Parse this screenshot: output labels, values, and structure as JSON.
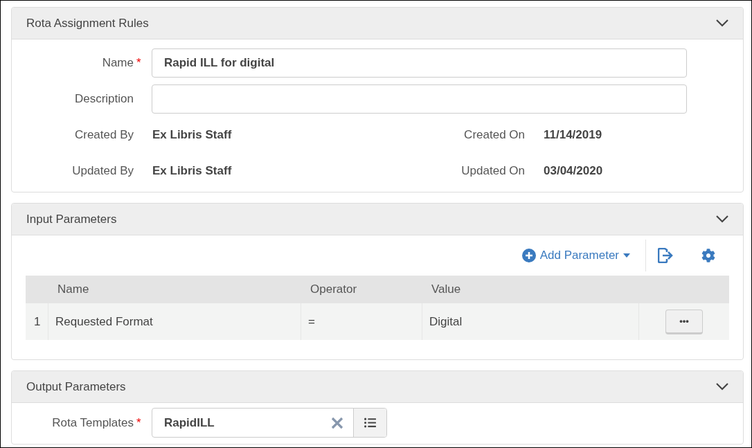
{
  "general": {
    "title": "Rota Assignment Rules",
    "expanded": true,
    "fields": [
      {
        "label": "Name",
        "required_mark": "*",
        "value": "Rapid ILL for digital"
      },
      {
        "label": "Description"
      }
    ],
    "info": [
      {
        "label": "Created By",
        "value": "Ex Libris Staff",
        "label_2": "Created On",
        "value_2": "11/14/2019"
      },
      {
        "label": "Updated By",
        "value": "Ex Libris Staff",
        "label_2": "Updated On",
        "value_2": "03/04/2020"
      }
    ]
  },
  "input_parameters": {
    "title": "Input Parameters",
    "expanded": true,
    "add_button": "Add Parameter",
    "columns": [
      "Name",
      "Operator",
      "Value"
    ],
    "rows": [
      {
        "index": "1",
        "name": "Requested Format",
        "operator": "=",
        "value": "Digital",
        "action": "•••"
      }
    ]
  },
  "output_parameters": {
    "title": "Output Parameters",
    "expanded": true,
    "field": {
      "label": "Rota Templates",
      "required_mark": "*",
      "value": "RapidILL"
    }
  }
}
